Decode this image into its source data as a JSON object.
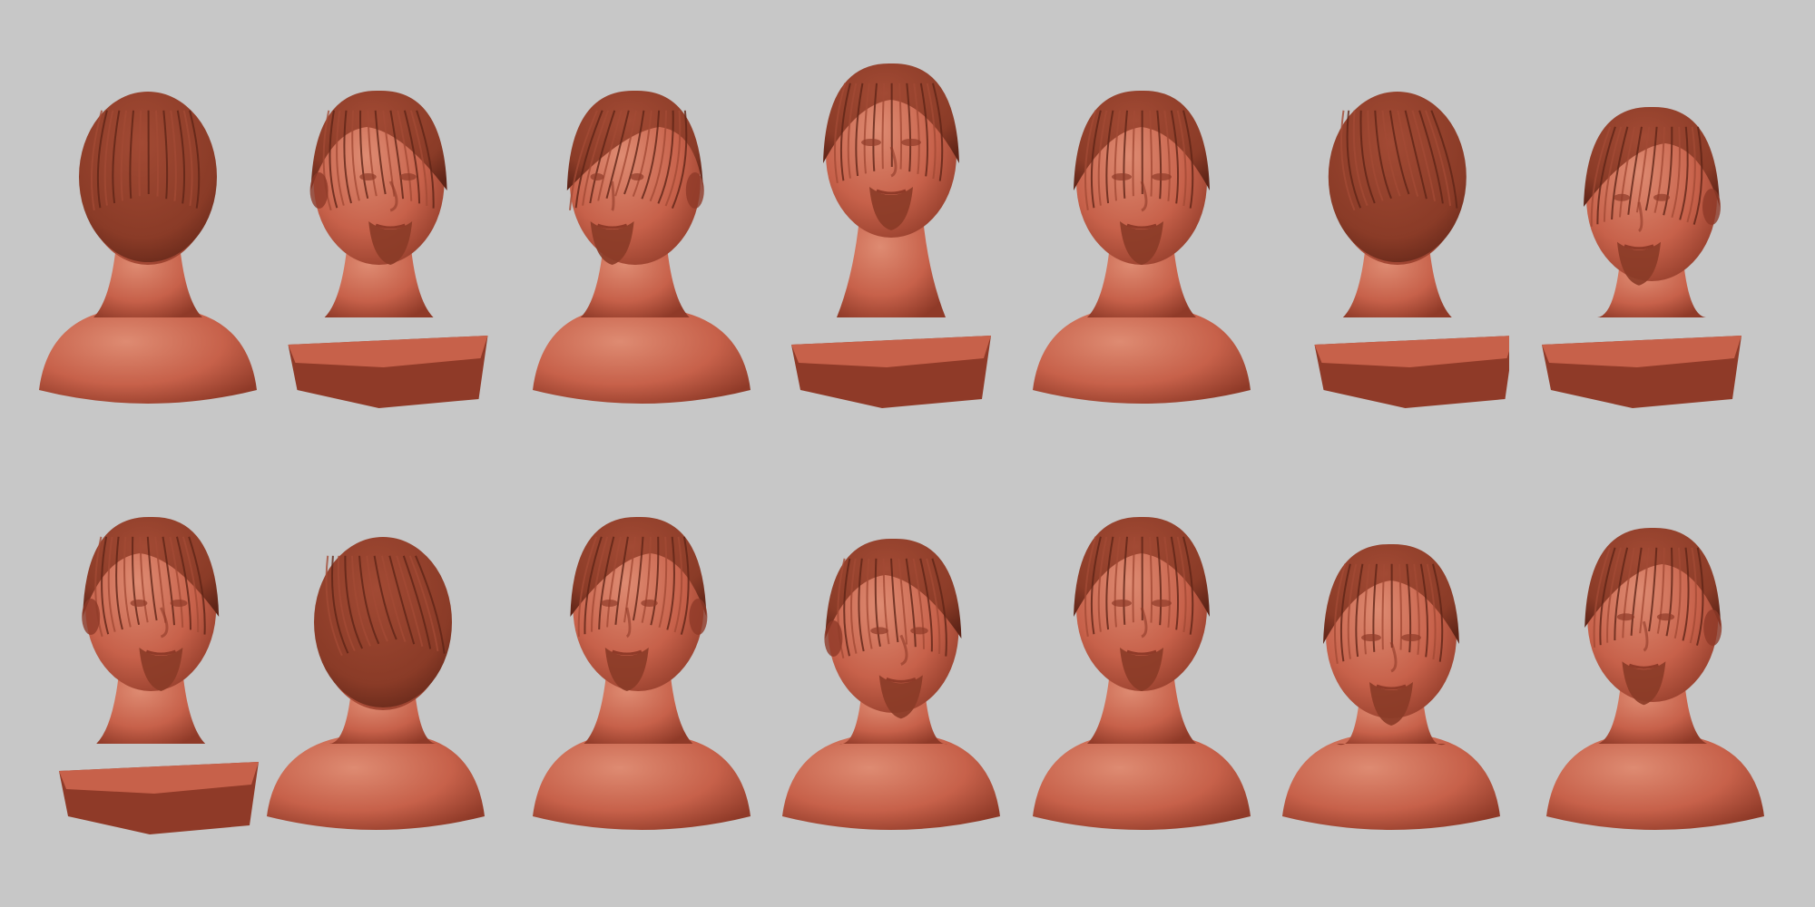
{
  "viewport": {
    "background": "#c7c7c7"
  },
  "material": {
    "skin": "#c7614a",
    "skin_light": "#de8b72",
    "skin_dark": "#8f3a28",
    "hair": "#8a3b27",
    "hair_dark": "#5e2417",
    "hair_strand": "#a24a34"
  },
  "rows": [
    {
      "views": [
        {
          "pose": "back",
          "head_turn": 0,
          "tilt": 0,
          "base": "shoulders"
        },
        {
          "pose": "three-quarter-right",
          "head_turn": 0.45,
          "tilt": 0,
          "base": "cut-block"
        },
        {
          "pose": "profile-left",
          "head_turn": -0.9,
          "tilt": 0,
          "base": "shoulders"
        },
        {
          "pose": "look-up",
          "head_turn": 0,
          "tilt": -1,
          "base": "cut-block"
        },
        {
          "pose": "front",
          "head_turn": 0,
          "tilt": 0,
          "base": "shoulders"
        },
        {
          "pose": "back-three-quarter",
          "head_turn": 0.85,
          "tilt": 0,
          "base": "cut-block"
        },
        {
          "pose": "tilted-down-left",
          "head_turn": -0.5,
          "tilt": 0.6,
          "base": "cut-block"
        }
      ]
    },
    {
      "views": [
        {
          "pose": "three-quarter-right",
          "head_turn": 0.4,
          "tilt": 0,
          "base": "cut-block"
        },
        {
          "pose": "top-back",
          "head_turn": 1,
          "tilt": 0.7,
          "base": "shoulders"
        },
        {
          "pose": "three-quarter-left",
          "head_turn": -0.45,
          "tilt": 0,
          "base": "shoulders"
        },
        {
          "pose": "look-down-right",
          "head_turn": 0.3,
          "tilt": 0.8,
          "base": "shoulders"
        },
        {
          "pose": "front",
          "head_turn": 0,
          "tilt": 0,
          "base": "shoulders"
        },
        {
          "pose": "look-down",
          "head_turn": 0,
          "tilt": 1,
          "base": "shoulders"
        },
        {
          "pose": "three-quarter-left-down",
          "head_turn": -0.35,
          "tilt": 0.4,
          "base": "shoulders"
        }
      ]
    }
  ]
}
